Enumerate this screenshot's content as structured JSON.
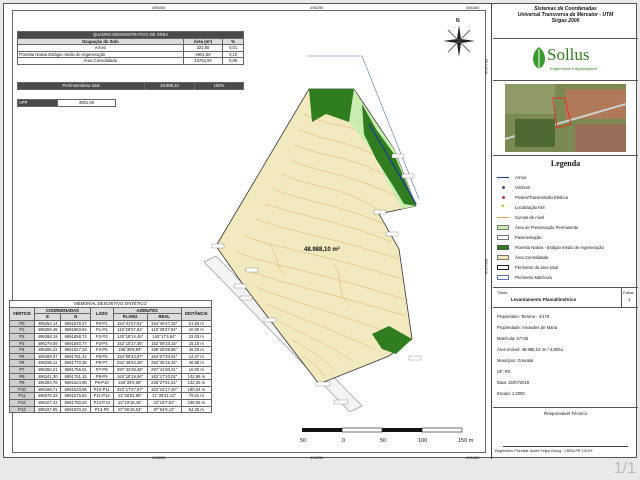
{
  "area_table": {
    "title": "QUADRO DEMONSTRATIVO DE ÁREA",
    "headers": [
      "Ocupação do Solo",
      "Área (m²)",
      "%"
    ],
    "rows": [
      [
        "Arroio",
        "322,60",
        "0,01"
      ],
      [
        "Floresta Nativa Estágio médio de regeneração",
        "4901,50",
        "0,10"
      ],
      [
        "Área Consolidada",
        "43764,00",
        "0,89"
      ]
    ],
    "perimeter": [
      "Perímetro/área total",
      "48.988,10",
      "100%"
    ],
    "app": [
      "APP",
      "4901,00"
    ]
  },
  "header": {
    "line1": "Sistemas de Coordenadas",
    "line2": "Universal Transversa de Mercator - UTM",
    "line3": "Sirgas 2000"
  },
  "logo": {
    "name": "Sollus",
    "tagline": "Engenharia e Agronegócio"
  },
  "map": {
    "area_label": "48.988,10 m²",
    "coords_top": [
      "496050",
      "496250",
      "496450"
    ],
    "coords_bottom": [
      "496050",
      "496250",
      "496450"
    ],
    "coord_left": "6737000",
    "coord_right": "6737700",
    "north": "N"
  },
  "scale_bar": {
    "labels": [
      "50",
      "0",
      "50",
      "100",
      "150 m"
    ]
  },
  "memorial": {
    "title": "MEMORIAL DESCRITIVO SINTÉTICO",
    "headers": [
      "VÉRTICE",
      "COORDENADAS",
      "LADO",
      "AZIMUTES",
      "DISTÂNCIA"
    ],
    "subheaders": [
      "E",
      "N",
      "PLANO",
      "REAL"
    ],
    "rows": [
      [
        "P0",
        "496252,14",
        "6691879,37",
        "P0-P1",
        "154°41'57,51\"",
        "154°40'47,32\"",
        "21,93 m"
      ],
      [
        "P1",
        "496259,48",
        "6691863,64",
        "P1-P2",
        "119°29'07,91\"",
        "119°39'27,84\"",
        "10,00 m"
      ],
      [
        "P2",
        "496268,19",
        "6691858,72",
        "P2-P3",
        "140°18'14,45\"",
        "140°17'4,64\"",
        "22,03 m"
      ],
      [
        "P3",
        "496279,59",
        "6691840,77",
        "P3-P4",
        "152°10'17,35\"",
        "152°09'33,15\"",
        "15,10 m"
      ],
      [
        "P4",
        "496286,22",
        "6691827,33",
        "P4-P5",
        "196°38'9,84\"",
        "196°36'58,86\"",
        "46,03 m"
      ],
      [
        "P5",
        "496289,37",
        "6691781,42",
        "P5-P6",
        "154°08'43,97\"",
        "154°07'33,91\"",
        "12,47 m"
      ],
      [
        "P6",
        "496295,11",
        "6691770,36",
        "P6-P7",
        "252°46'54,46\"",
        "252°45'45,34\"",
        "46,88 m"
      ],
      [
        "P7",
        "496250,21",
        "6691756,51",
        "P7-P8",
        "297°42'39,48\"",
        "297°41'30,01\"",
        "10,00 m"
      ],
      [
        "P8",
        "496241,30",
        "6691761,15",
        "P8-P9",
        "162°18'19,94\"",
        "162°17'10,02\"",
        "142,99 m"
      ],
      [
        "P9",
        "496284,76",
        "6691624,96",
        "P9-P10",
        "226°29'2,08\"",
        "226°27'51,61\"",
        "132,35 m"
      ],
      [
        "P10",
        "496188,71",
        "6691533,86",
        "P10-P11",
        "322°17'27,57\"",
        "322°16'17,40\"",
        "180,34 m"
      ],
      [
        "P11",
        "496078,23",
        "6691676,62",
        "P11-P12",
        "21°40'51,85\"",
        "21°39'41,12\"",
        "79,01 m"
      ],
      [
        "P12",
        "496107,42",
        "6691750,04",
        "P12-P13",
        "22°19'18,45\"",
        "22°18'7,81\"",
        "238,05 m"
      ],
      [
        "P13",
        "496197,85",
        "6691970,23",
        "P13-P0",
        "87°55'19,04\"",
        "87°54'9,12\"",
        "54,00 m"
      ]
    ]
  },
  "legend": {
    "title": "Legenda",
    "items": [
      {
        "label": "Arroio",
        "sym": "line-blue"
      },
      {
        "label": "Vértices",
        "sym": "dot-purple"
      },
      {
        "label": "Postes/Transmissão Elétrica",
        "sym": "dot-red"
      },
      {
        "label": "Localização KM",
        "sym": "star"
      },
      {
        "label": "Curvas de nível",
        "sym": "line-tan"
      },
      {
        "label": "Área de Preservação Permanente",
        "sym": "box-lightgreen"
      },
      {
        "label": "Pavimentação",
        "sym": "box-white"
      },
      {
        "label": "Floresta Nativa - Estágio médio de regeneração",
        "sym": "box-darkgreen"
      },
      {
        "label": "Área Consolidada",
        "sym": "box-cream"
      },
      {
        "label": "Perímetro da área total",
        "sym": "box-outline"
      },
      {
        "label": "Perímetro Matrícula",
        "sym": "box-outline-blue"
      }
    ]
  },
  "info": {
    "titulo_label": "Título:",
    "folha_label": "Folha:",
    "titulo": "Levantamento Planialtimétrico",
    "folha": "1",
    "lines": [
      "Proprietário: Terreno - n/176",
      "Propriedade: Arvaedes de Maria",
      "Matrícula: 67745",
      "Área Imóvel: 48.988,10 m² / 4,90ha",
      "Município: Gravataí",
      "UF: RS",
      "Data: 15/07/2019",
      "Escala: 1:2000"
    ],
    "responsavel": "Responsável Técnico",
    "engenheiro": "Engenheiro Florestal: André Felipe Droog - CREA-PR 1X1XX"
  },
  "page_indicator": "1/1",
  "colors": {
    "cream": "#f3e9bf",
    "contour": "#d9a85e",
    "forest": "#2f7d1e",
    "app": "#c9eeb0",
    "arroio": "#1d3f8f"
  }
}
